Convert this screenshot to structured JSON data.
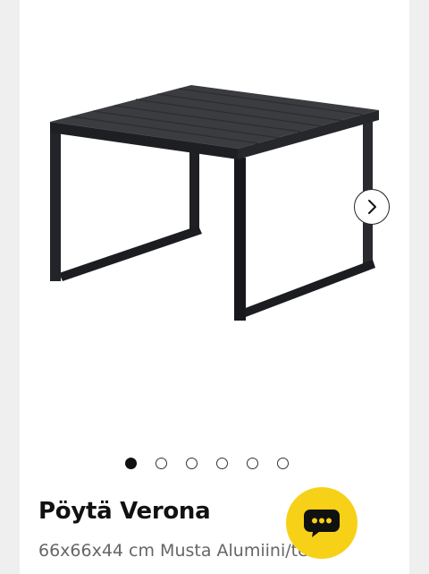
{
  "product": {
    "title": "Pöytä Verona",
    "subtitle": "66x66x44 cm Musta Alumiini/teräs"
  },
  "gallery": {
    "image_count": 6,
    "active_index": 0,
    "next_icon": "chevron-right-icon"
  },
  "chat": {
    "icon": "chat-bubble-icon",
    "color": "#f7d117"
  }
}
